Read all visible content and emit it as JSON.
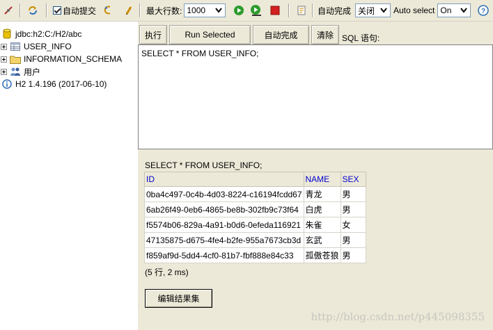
{
  "toolbar": {
    "auto_commit_label": "自动提交",
    "max_rows_label": "最大行数:",
    "max_rows_value": "1000",
    "auto_complete_label": "自动完成",
    "auto_complete_value": "关闭",
    "auto_select_label": "Auto select",
    "auto_select_value": "On",
    "help_glyph": "?"
  },
  "tree": {
    "connection": "jdbc:h2:C:/H2/abc",
    "items": [
      {
        "label": "USER_INFO",
        "icon": "table-icon"
      },
      {
        "label": "INFORMATION_SCHEMA",
        "icon": "folder-icon"
      },
      {
        "label": "用户",
        "icon": "users-icon"
      }
    ],
    "version": "H2 1.4.196 (2017-06-10)"
  },
  "editor": {
    "execute_label": "执行",
    "run_selected_label": "Run Selected",
    "auto_complete_label": "自动完成",
    "clear_label": "清除",
    "sql_label": "SQL 语句:",
    "sql_text": "SELECT * FROM USER_INFO;"
  },
  "result": {
    "query": "SELECT * FROM USER_INFO;",
    "columns": [
      "ID",
      "NAME",
      "SEX"
    ],
    "rows": [
      [
        "0ba4c497-0c4b-4d03-8224-c16194fcdd67",
        "青龙",
        "男"
      ],
      [
        "6ab26f49-0eb6-4865-be8b-302fb9c73f64",
        "白虎",
        "男"
      ],
      [
        "f5574b06-829a-4a91-b0d6-0efeda116921",
        "朱雀",
        "女"
      ],
      [
        "47135875-d675-4fe4-b2fe-955a7673cb3d",
        "玄武",
        "男"
      ],
      [
        "f859af9d-5dd4-4cf0-81b7-fbf888e84c33",
        "孤傲苍狼",
        "男"
      ]
    ],
    "summary": "(5 行, 2 ms)",
    "edit_button_label": "编辑结果集"
  },
  "watermark": "http://blog.csdn.net/p445098355",
  "colors": {
    "panel_bg": "#ece9d8",
    "header_text": "#0000cc",
    "run_green": "#2e9b2e",
    "stop_red": "#d42020"
  }
}
